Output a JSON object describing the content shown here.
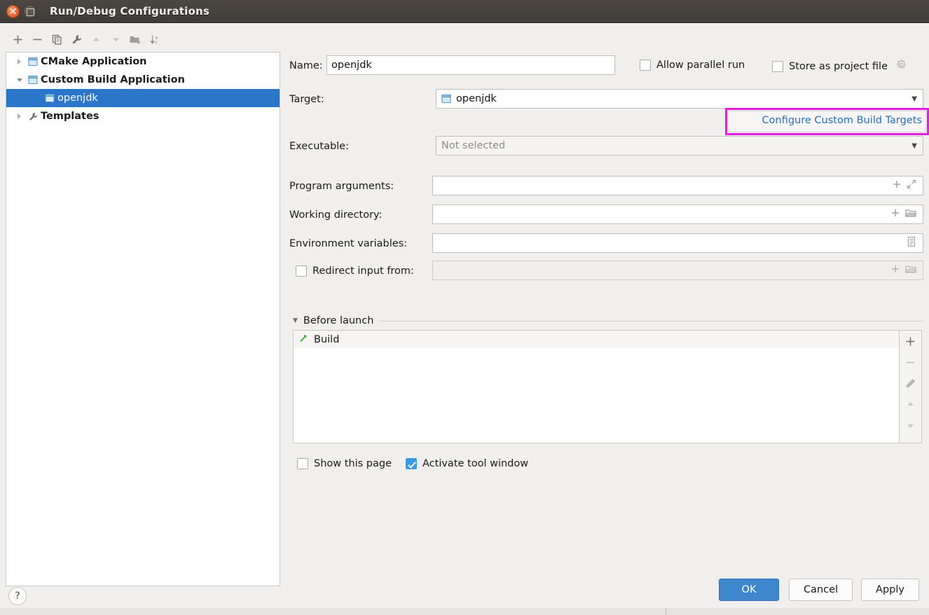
{
  "window": {
    "title": "Run/Debug Configurations",
    "close_icon": "close-icon",
    "maximize_icon": "maximize-icon"
  },
  "tree_toolbar": {
    "items": [
      {
        "name": "add-button",
        "icon": "plus-icon",
        "label": "+"
      },
      {
        "name": "remove-button",
        "icon": "minus-icon",
        "label": "−"
      },
      {
        "name": "copy-button",
        "icon": "copy-icon",
        "label": "copy"
      },
      {
        "name": "edit-templates-button",
        "icon": "wrench-icon",
        "label": "wrench"
      },
      {
        "name": "move-up-button",
        "icon": "arrow-up-icon",
        "label": "up"
      },
      {
        "name": "move-down-button",
        "icon": "arrow-down-icon",
        "label": "down"
      },
      {
        "name": "move-into-folder-button",
        "icon": "folder-add-icon",
        "label": "folder"
      },
      {
        "name": "sort-button",
        "icon": "sort-az-icon",
        "label": "sort"
      }
    ]
  },
  "tree": {
    "nodes": [
      {
        "label": "CMake Application",
        "expander": "collapsed",
        "icon": "application-icon",
        "depth": 0,
        "selected": false,
        "bold": true
      },
      {
        "label": "Custom Build Application",
        "expander": "expanded",
        "icon": "application-icon",
        "depth": 0,
        "selected": false,
        "bold": true
      },
      {
        "label": "openjdk",
        "expander": "none",
        "icon": "application-icon",
        "depth": 1,
        "selected": true,
        "bold": false
      },
      {
        "label": "Templates",
        "expander": "collapsed",
        "icon": "wrench-icon",
        "depth": 0,
        "selected": false,
        "bold": true
      }
    ]
  },
  "form": {
    "name_label": "Name:",
    "name_value": "openjdk",
    "allow_parallel_run_label": "Allow parallel run",
    "allow_parallel_run_checked": false,
    "store_as_project_file_label": "Store as project file",
    "store_as_project_file_checked": false,
    "store_gear_icon": "gear-icon",
    "target_label": "Target:",
    "target_value": "openjdk",
    "target_icon": "application-icon",
    "configure_link": "Configure Custom Build Targets",
    "executable_label": "Executable:",
    "executable_placeholder": "Not selected",
    "program_arguments_label": "Program arguments:",
    "program_arguments_value": "",
    "program_arguments_icons": [
      "plus-icon",
      "expand-icon"
    ],
    "working_directory_label": "Working directory:",
    "working_directory_value": "",
    "working_directory_icons": [
      "plus-icon",
      "folder-icon"
    ],
    "environment_variables_label": "Environment variables:",
    "environment_variables_value": "",
    "environment_variables_icons": [
      "list-document-icon"
    ],
    "redirect_input_label": "Redirect input from:",
    "redirect_input_checked": false,
    "redirect_input_value": "",
    "redirect_input_icons": [
      "plus-icon",
      "folder-icon"
    ]
  },
  "before_launch": {
    "section_title": "Before launch",
    "collapsed": false,
    "tasks": [
      {
        "label": "Build",
        "icon": "hammer-icon"
      }
    ],
    "side_buttons": [
      {
        "name": "add-task-button",
        "icon": "plus-icon"
      },
      {
        "name": "remove-task-button",
        "icon": "minus-icon"
      },
      {
        "name": "edit-task-button",
        "icon": "pencil-icon"
      },
      {
        "name": "move-task-up-button",
        "icon": "arrow-up-icon"
      },
      {
        "name": "move-task-down-button",
        "icon": "arrow-down-icon"
      }
    ],
    "show_this_page_label": "Show this page",
    "show_this_page_checked": false,
    "activate_tool_window_label": "Activate tool window",
    "activate_tool_window_checked": true
  },
  "footer": {
    "help_label": "?",
    "ok_label": "OK",
    "cancel_label": "Cancel",
    "apply_label": "Apply"
  },
  "colors": {
    "selection_blue": "#2b76c8",
    "primary_button": "#3e87cd",
    "link_blue": "#2b6eb5",
    "highlight_magenta": "#e020e0",
    "checkbox_checked": "#3d9ae2",
    "titlebar": "#403c38",
    "window_background": "#f0efee",
    "hammer_green": "#4fa84f"
  }
}
